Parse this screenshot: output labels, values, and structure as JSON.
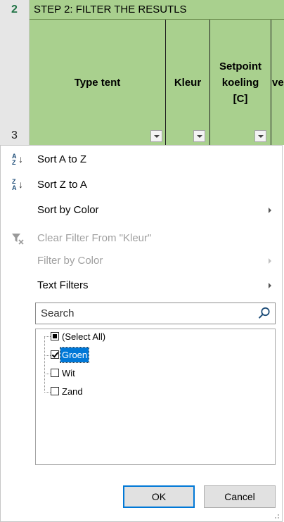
{
  "sheet": {
    "row2_number": "2",
    "row3_number": "3",
    "section_title": "STEP 2: FILTER THE RESUTLS",
    "headers": {
      "type_tent": "Type tent",
      "kleur": "Kleur",
      "setpoint": "Setpoint\nkoeling\n[C]",
      "next": "ve"
    },
    "colors": {
      "header_green": "#a9d08e",
      "row_header_gray": "#e6e6e6"
    }
  },
  "menu": {
    "sort_az": "Sort A to Z",
    "sort_za": "Sort Z to A",
    "sort_by_color": "Sort by Color",
    "clear_filter": "Clear Filter From \"Kleur\"",
    "filter_by_color": "Filter by Color",
    "text_filters": "Text Filters"
  },
  "search": {
    "placeholder": "Search"
  },
  "filter_list": {
    "items": [
      {
        "label": "(Select All)",
        "state": "partial"
      },
      {
        "label": "Groen",
        "state": "checked",
        "selected": true
      },
      {
        "label": "Wit",
        "state": "unchecked"
      },
      {
        "label": "Zand",
        "state": "unchecked"
      }
    ]
  },
  "buttons": {
    "ok": "OK",
    "cancel": "Cancel"
  },
  "accent_color": "#0078d7"
}
